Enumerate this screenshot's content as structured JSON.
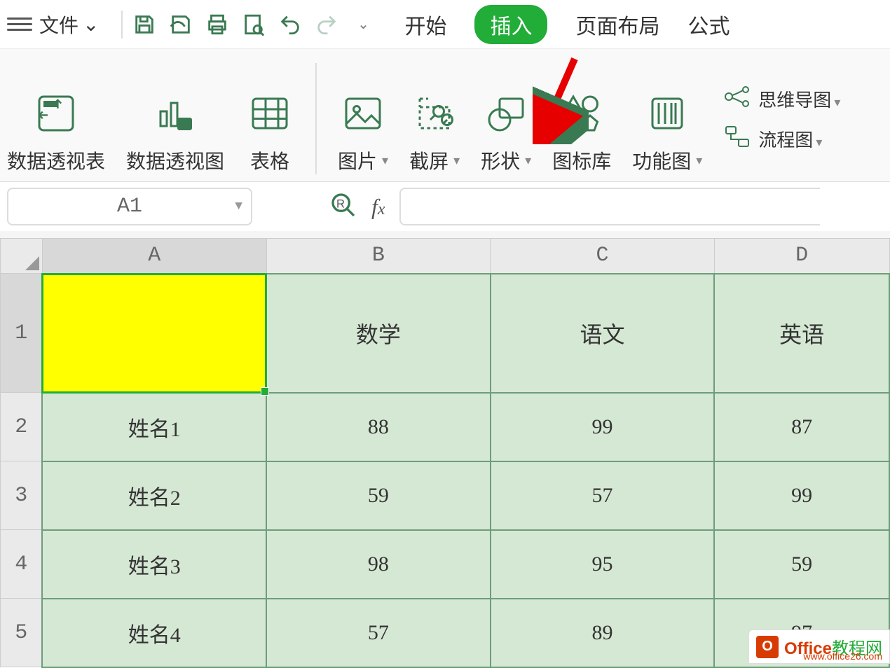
{
  "topbar": {
    "file_label": "文件"
  },
  "tabs": {
    "start": "开始",
    "insert": "插入",
    "layout": "页面布局",
    "formula": "公式"
  },
  "ribbon": {
    "pivot_table": "数据透视表",
    "pivot_chart": "数据透视图",
    "table": "表格",
    "picture": "图片",
    "screenshot": "截屏",
    "shapes": "形状",
    "icons": "图标库",
    "smartart": "功能图",
    "mindmap": "思维导图",
    "flowchart": "流程图"
  },
  "namebox": {
    "value": "A1"
  },
  "columns": [
    "A",
    "B",
    "C",
    "D"
  ],
  "rows": [
    "1",
    "2",
    "3",
    "4",
    "5"
  ],
  "headers": {
    "math": "数学",
    "chinese": "语文",
    "english": "英语"
  },
  "data": [
    {
      "name": "姓名1",
      "math": "88",
      "chinese": "99",
      "english": "87"
    },
    {
      "name": "姓名2",
      "math": "59",
      "chinese": "57",
      "english": "99"
    },
    {
      "name": "姓名3",
      "math": "98",
      "chinese": "95",
      "english": "59"
    },
    {
      "name": "姓名4",
      "math": "57",
      "chinese": "89",
      "english": "97"
    }
  ],
  "watermark": {
    "brand": "Office",
    "suffix": "教程网",
    "url": "www.office26.com"
  },
  "chart_data": {
    "type": "table",
    "title": "",
    "columns": [
      "",
      "数学",
      "语文",
      "英语"
    ],
    "rows": [
      [
        "姓名1",
        88,
        99,
        87
      ],
      [
        "姓名2",
        59,
        57,
        99
      ],
      [
        "姓名3",
        98,
        95,
        59
      ],
      [
        "姓名4",
        57,
        89,
        97
      ]
    ]
  }
}
